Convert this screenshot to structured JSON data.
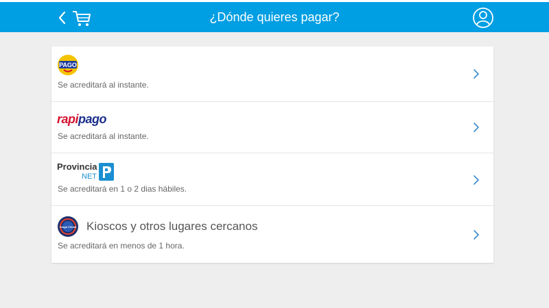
{
  "header": {
    "title": "¿Dónde quieres pagar?",
    "back_icon": "chevron-left-icon",
    "cart_icon": "cart-icon",
    "user_icon": "user-icon",
    "accent_color": "#009ee3"
  },
  "options": [
    {
      "logo": "pago-facil-logo",
      "logo_text": "PAGO",
      "description": "Se acreditará al instante."
    },
    {
      "logo": "rapipago-logo",
      "logo_text_a": "rapi",
      "logo_text_b": "pago",
      "description": "Se acreditará al instante."
    },
    {
      "logo": "provincia-net-logo",
      "logo_text_a": "Provincia",
      "logo_text_b": "NET",
      "description": "Se acreditará en 1 o 2 dias hábiles."
    },
    {
      "logo": "carga-virtual-logo",
      "logo_text": "Carga Virtual",
      "label": "Kioscos y otros lugares cercanos",
      "description": "Se acreditará en menos de 1 hora."
    }
  ]
}
